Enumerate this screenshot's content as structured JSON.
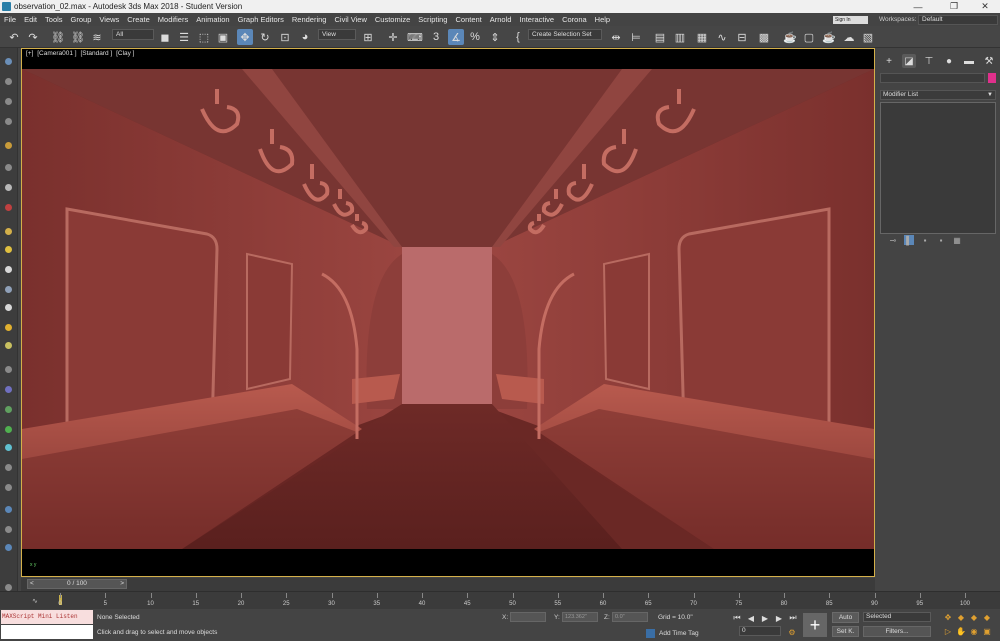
{
  "window": {
    "title": "observation_02.max - Autodesk 3ds Max 2018 - Student Version",
    "min": "—",
    "restore": "❐",
    "close": "✕"
  },
  "menu": [
    "File",
    "Edit",
    "Tools",
    "Group",
    "Views",
    "Create",
    "Modifiers",
    "Animation",
    "Graph Editors",
    "Rendering",
    "Civil View",
    "Customize",
    "Scripting",
    "Content",
    "Arnold",
    "Interactive",
    "Corona",
    "Help"
  ],
  "signin": "Sign In",
  "workspaces": {
    "label": "Workspaces:",
    "value": "Default"
  },
  "toolbar": {
    "filter": "All",
    "refcoord": "View",
    "selection_set": "Create Selection Set"
  },
  "viewport": {
    "labels": [
      "[+]",
      "[Camera001 ]",
      "[Standard ]",
      "[Clay ]"
    ],
    "axis": "x y"
  },
  "command_panel": {
    "modifier_list": "Modifier List"
  },
  "time": {
    "slider": "0 / 100",
    "prev": "<",
    "next": ">"
  },
  "track": {
    "ticks": [
      "0",
      "5",
      "10",
      "15",
      "20",
      "25",
      "30",
      "35",
      "40",
      "45",
      "50",
      "55",
      "60",
      "65",
      "70",
      "75",
      "80",
      "85",
      "90",
      "95",
      "100"
    ]
  },
  "status": {
    "maxscript": "MAXScript Mini Listen",
    "selection": "None Selected",
    "prompt": "Click and drag to select and move objects",
    "x_label": "X:",
    "x_value": "",
    "y_label": "Y:",
    "y_value": "123.362\"",
    "z_label": "Z:",
    "z_value": "0.0\"",
    "grid": "Grid = 10.0\"",
    "add_time_tag": "Add Time Tag",
    "frame": "0",
    "auto": "Auto",
    "setk": "Set K.",
    "selected": "Selected",
    "filters": "Filters..."
  },
  "colors": {
    "accent": "#5b87b8",
    "viewport_border": "#d4b04a",
    "object_color": "#e0308c",
    "clay": "#8a3a36"
  }
}
